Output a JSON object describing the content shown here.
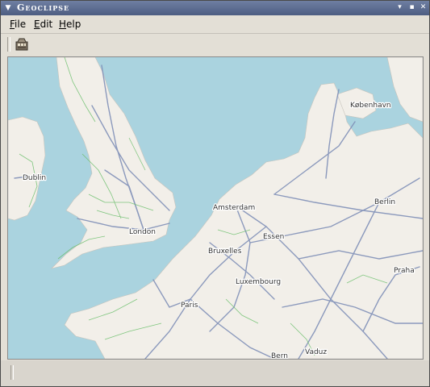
{
  "window": {
    "title": "Geoclipse",
    "sysmenu_icon": "window-menu-arrow-icon",
    "controls": [
      "minimize-icon",
      "maximize-icon",
      "close-icon"
    ]
  },
  "menubar": {
    "file": {
      "mnemonic": "F",
      "rest": "ile"
    },
    "edit": {
      "mnemonic": "E",
      "rest": "dit"
    },
    "help": {
      "mnemonic": "H",
      "rest": "elp"
    }
  },
  "toolbar": {
    "buttons": [
      {
        "icon": "map-layers-icon"
      }
    ]
  },
  "map": {
    "cities": {
      "dublin": "Dublin",
      "london": "London",
      "amsterdam": "Amsterdam",
      "essen": "Essen",
      "bruxelles": "Bruxelles",
      "luxembourg": "Luxembourg",
      "paris": "Paris",
      "kobenhavn": "København",
      "berlin": "Berlin",
      "praha": "Praha",
      "vaduz": "Vaduz",
      "bern": "Bern"
    },
    "colors": {
      "sea": "#aad3df",
      "land": "#f2efe9",
      "motorway": "#8090b8",
      "minor_road": "#6cbf6c"
    }
  },
  "statusbar": {
    "text": ""
  }
}
